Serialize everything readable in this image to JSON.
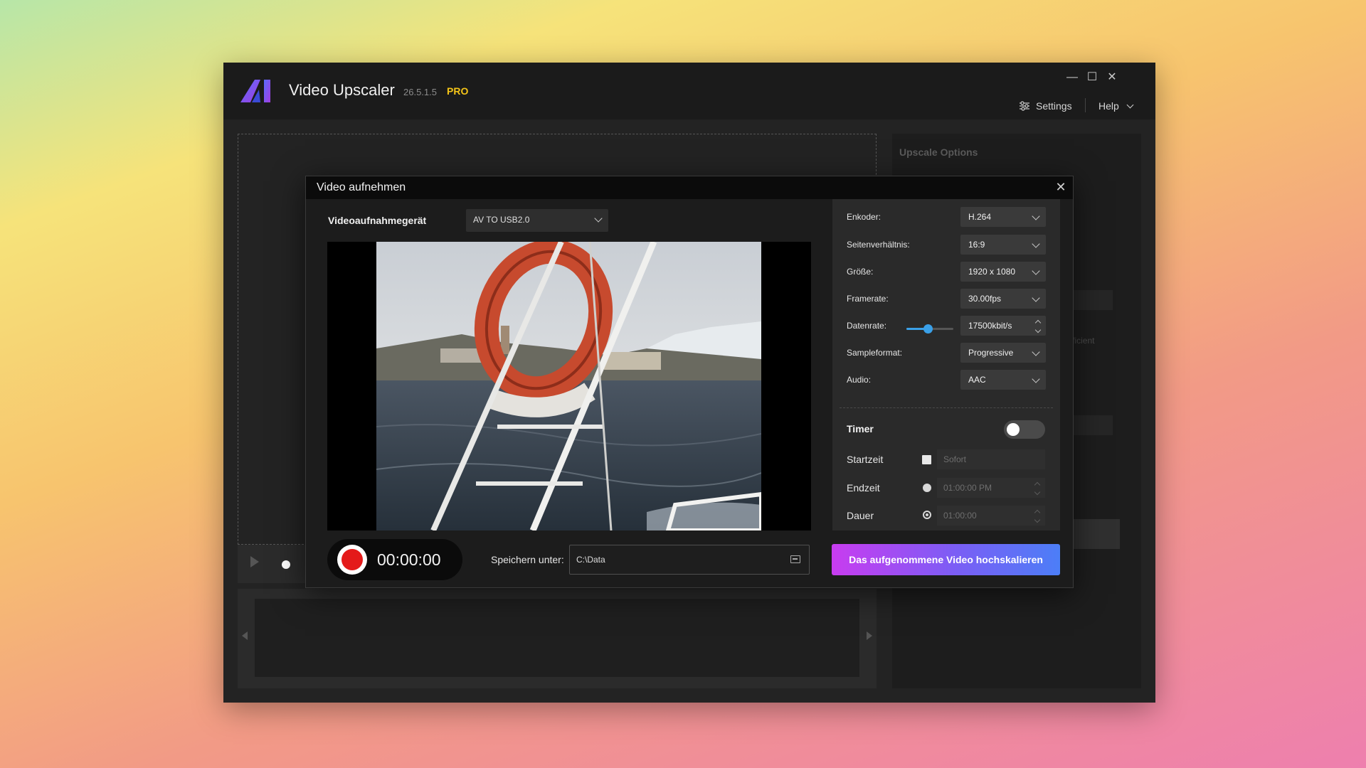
{
  "app": {
    "title": "Video Upscaler",
    "version": "26.5.1.5",
    "edition": "PRO",
    "window_controls": {
      "minimize": "—",
      "maximize": "☐",
      "close": "✕"
    },
    "header": {
      "settings_label": "Settings",
      "help_label": "Help"
    },
    "right_panel": {
      "title": "Upscale Options",
      "fragment_text": "fficient"
    }
  },
  "colors": {
    "accent_blue": "#3aa0e8",
    "record_red": "#e41a1a",
    "pro_yellow": "#f5c518",
    "gradient_start": "#c83cf0",
    "gradient_end": "#4c7ef7"
  },
  "icons": [
    "app-logo-icon",
    "settings-sliders-icon",
    "chevron-down-icon",
    "close-icon",
    "play-icon",
    "folder-icon",
    "record-icon"
  ],
  "dialog": {
    "title": "Video aufnehmen",
    "close": "✕",
    "device": {
      "label": "Videoaufnahmegerät",
      "value": "AV TO USB2.0"
    },
    "recording": {
      "time": "00:00:00"
    },
    "save": {
      "label": "Speichern unter:",
      "path": "C:\\Data"
    },
    "settings": {
      "encoder": {
        "label": "Enkoder:",
        "value": "H.264"
      },
      "aspect": {
        "label": "Seitenverhältnis:",
        "value": "16:9"
      },
      "size": {
        "label": "Größe:",
        "value": "1920 x 1080"
      },
      "framerate": {
        "label": "Framerate:",
        "value": "30.00fps"
      },
      "bitrate": {
        "label": "Datenrate:",
        "value": "17500kbit/s",
        "slider_fraction": 0.45
      },
      "sampleformat": {
        "label": "Sampleformat:",
        "value": "Progressive"
      },
      "audio": {
        "label": "Audio:",
        "value": "AAC"
      }
    },
    "timer": {
      "label": "Timer",
      "enabled": false,
      "start": {
        "label": "Startzeit",
        "value": "Sofort",
        "checked": true
      },
      "end": {
        "label": "Endzeit",
        "value": "01:00:00 PM"
      },
      "duration": {
        "label": "Dauer",
        "value": "01:00:00",
        "selected": true
      }
    },
    "upscale_button": "Das aufgenommene Video hochskalieren"
  }
}
